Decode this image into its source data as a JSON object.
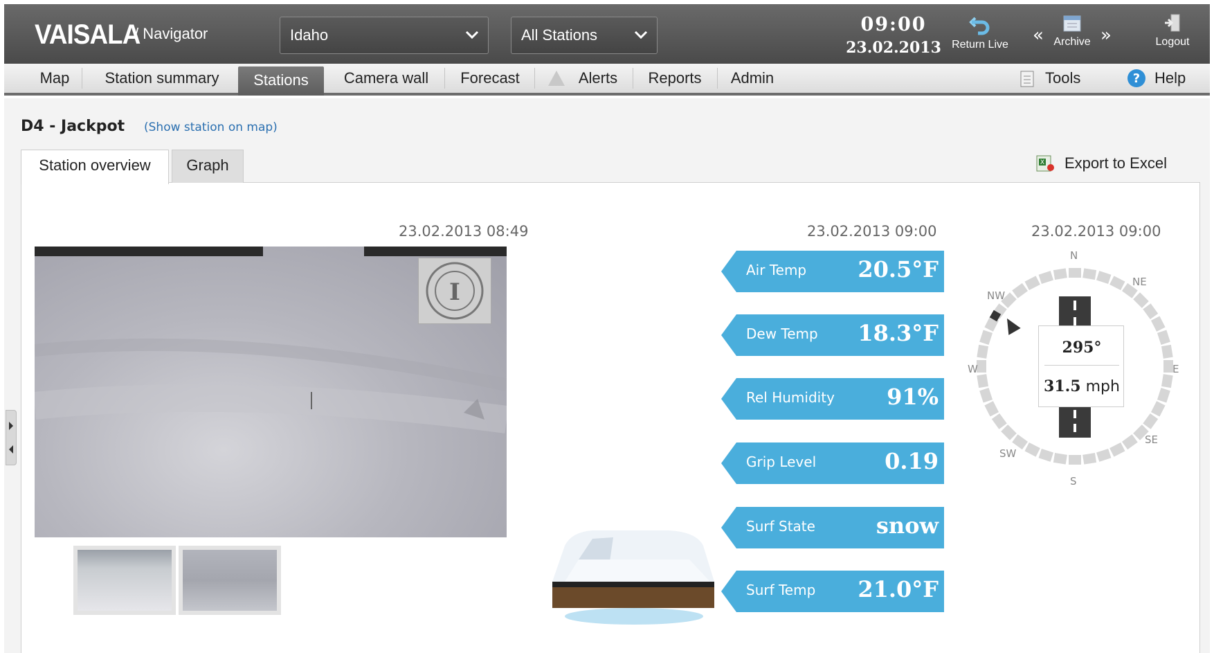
{
  "header": {
    "logo": "VAISALA",
    "product": "/ Navigator",
    "region_select": "Idaho",
    "station_select": "All Stations",
    "time": "09:00",
    "date": "23.02.2013",
    "return_live": "Return Live",
    "archive": "Archive",
    "archive_prev": "«",
    "archive_next": "»",
    "logout": "Logout"
  },
  "nav": {
    "items": [
      "Map",
      "Station summary",
      "Stations",
      "Camera wall",
      "Forecast",
      "Alerts",
      "Reports",
      "Admin"
    ],
    "active": "Stations",
    "tools": "Tools",
    "help": "Help"
  },
  "station": {
    "title": "D4 - Jackpot",
    "show_on_map": "(Show station on map)",
    "tabs": [
      "Station overview",
      "Graph"
    ],
    "active_tab": "Station overview",
    "export": "Export to Excel"
  },
  "camera": {
    "timestamp": "23.02.2013 08:49"
  },
  "measurements": {
    "timestamp": "23.02.2013 09:00",
    "items": [
      {
        "label": "Air Temp",
        "value": "20.5°F"
      },
      {
        "label": "Dew Temp",
        "value": "18.3°F"
      },
      {
        "label": "Rel Humidity",
        "value": "91%"
      },
      {
        "label": "Grip Level",
        "value": "0.19"
      },
      {
        "label": "Surf State",
        "value": "snow"
      },
      {
        "label": "Surf Temp",
        "value": "21.0°F"
      }
    ]
  },
  "wind": {
    "timestamp": "23.02.2013 09:00",
    "direction": "295°",
    "speed_value": "31.5",
    "speed_unit": "mph",
    "directions": {
      "n": "N",
      "ne": "NE",
      "e": "E",
      "se": "SE",
      "s": "S",
      "sw": "SW",
      "w": "W",
      "nw": "NW"
    }
  },
  "colors": {
    "tag_blue": "#4aaedc",
    "header_gray": "#555555"
  }
}
